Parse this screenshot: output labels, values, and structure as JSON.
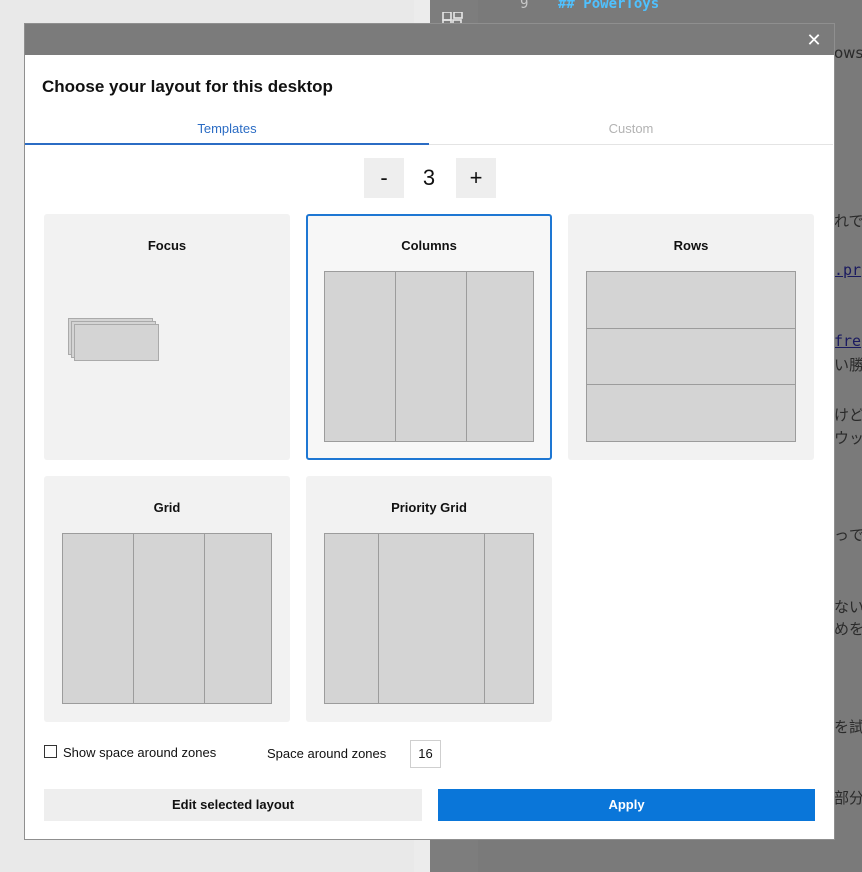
{
  "background": {
    "line_number": "9",
    "code_line": "## PowerToys",
    "peek_lines": [
      "ows",
      "れで",
      ".pr",
      "fre",
      "い勝",
      "けど",
      "ウッ",
      "っで",
      "ない",
      "めを",
      "を試",
      "部分"
    ]
  },
  "dialog": {
    "title": "Choose your layout for this desktop",
    "close_label": "✕",
    "tabs": {
      "templates": "Templates",
      "custom": "Custom"
    },
    "zone_count": {
      "minus": "-",
      "value": "3",
      "plus": "+"
    },
    "layouts": [
      {
        "name": "Focus",
        "selected": false
      },
      {
        "name": "Columns",
        "selected": true
      },
      {
        "name": "Rows",
        "selected": false
      },
      {
        "name": "Grid",
        "selected": false
      },
      {
        "name": "Priority Grid",
        "selected": false
      }
    ],
    "show_space_label": "Show space around zones",
    "show_space_checked": false,
    "space_label": "Space around zones",
    "space_value": "16",
    "edit_button": "Edit selected layout",
    "apply_button": "Apply"
  },
  "colors": {
    "accent": "#0a76d9",
    "tab_active": "#2b6cc4",
    "zone_fill": "#d4d4d4"
  }
}
